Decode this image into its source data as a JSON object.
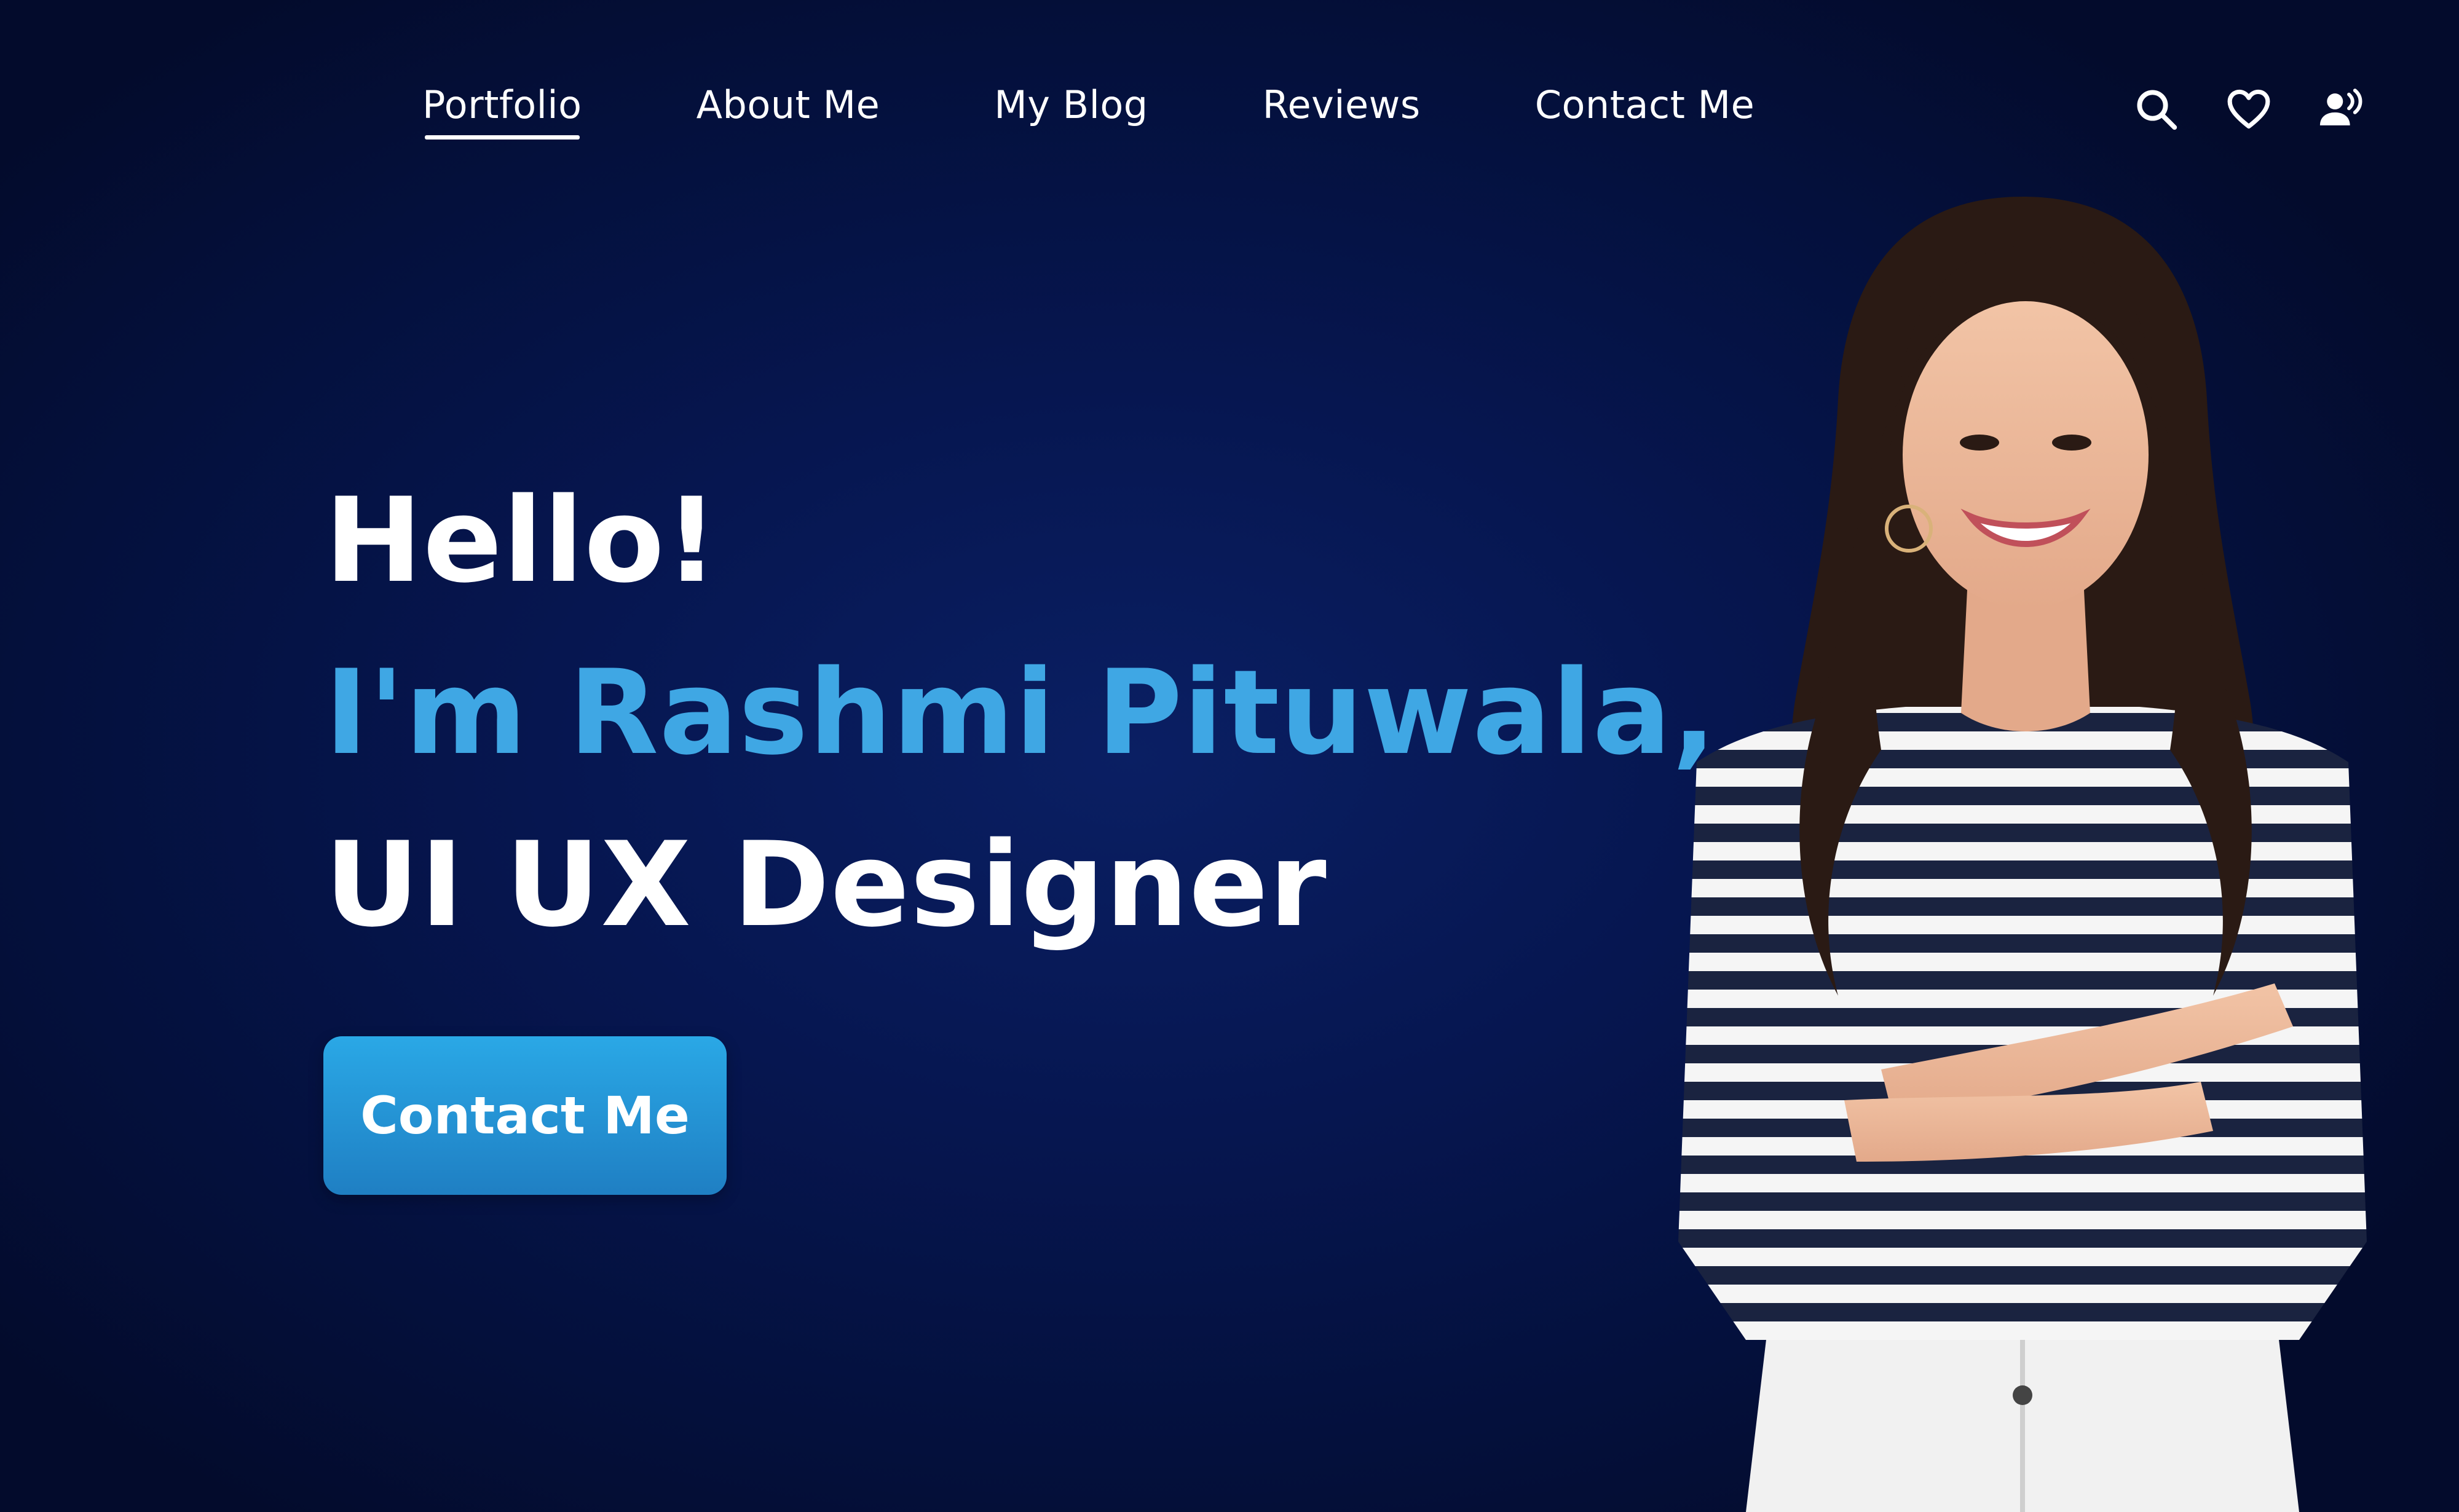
{
  "nav": {
    "items": [
      {
        "label": "Portfolio",
        "active": true
      },
      {
        "label": "About Me",
        "active": false
      },
      {
        "label": "My Blog",
        "active": false
      },
      {
        "label": "Reviews",
        "active": false
      },
      {
        "label": "Contact Me",
        "active": false
      }
    ],
    "icons": [
      "search-icon",
      "heart-icon",
      "user-voice-icon"
    ]
  },
  "hero": {
    "greeting": "Hello!",
    "name": "I'm Rashmi Pituwala,",
    "role": "UI UX Designer",
    "cta_label": "Contact Me"
  },
  "colors": {
    "background": "#061650",
    "accent": "#3fa7e4",
    "button": "#2394d6",
    "text": "#ffffff"
  }
}
